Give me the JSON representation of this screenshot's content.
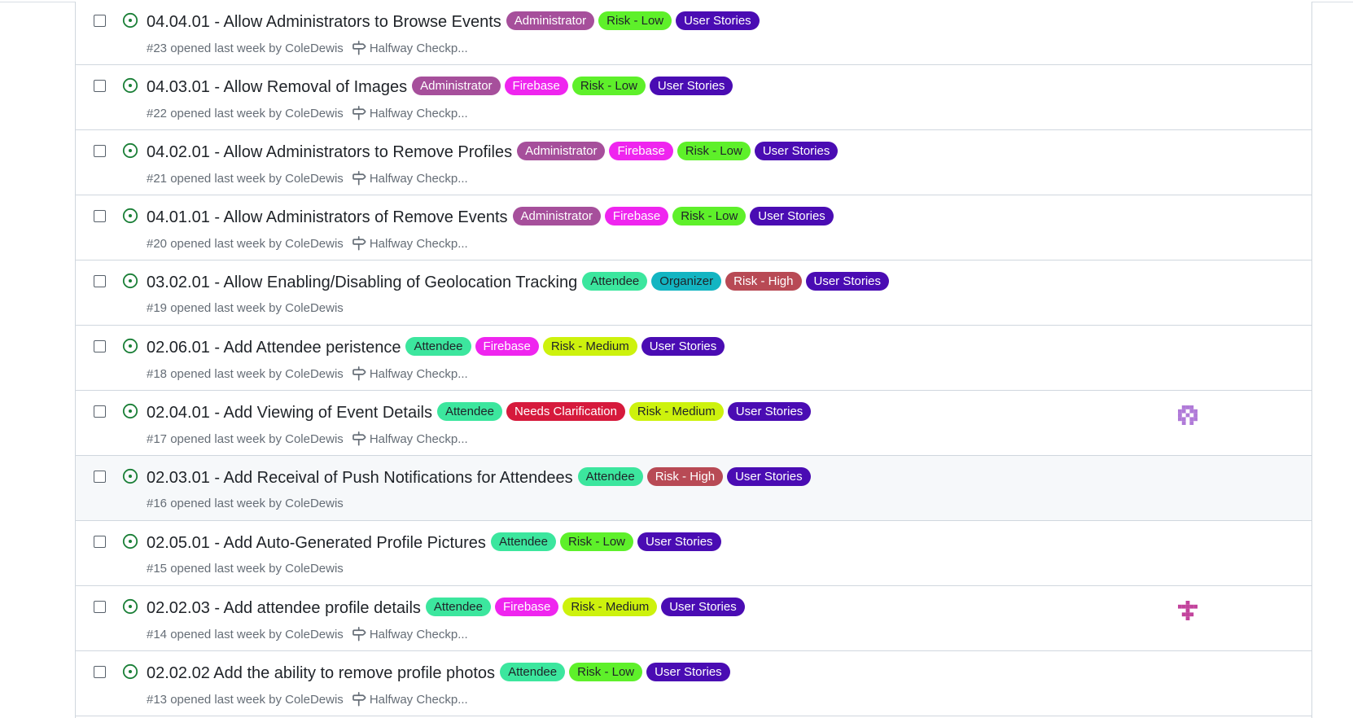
{
  "colors": {
    "Administrator": {
      "bg": "#a64f9b",
      "fg": "#ffffff"
    },
    "Firebase": {
      "bg": "#ef25ef",
      "fg": "#ffffff"
    },
    "Risk - Low": {
      "bg": "#5ef02a",
      "fg": "#1f2328"
    },
    "Risk - Medium": {
      "bg": "#cdf20d",
      "fg": "#1f2328"
    },
    "Risk - High": {
      "bg": "#b84a55",
      "fg": "#ffffff"
    },
    "User Stories": {
      "bg": "#4a0cb3",
      "fg": "#ffffff"
    },
    "Attendee": {
      "bg": "#3ce69e",
      "fg": "#1f2328"
    },
    "Organizer": {
      "bg": "#13b5c2",
      "fg": "#1f2328"
    },
    "Needs Clarification": {
      "bg": "#d61a3c",
      "fg": "#ffffff"
    },
    "open_state": "#1a7f37"
  },
  "issues": [
    {
      "title": "04.04.01 - Allow Administrators to Browse Events",
      "labels": [
        "Administrator",
        "Risk - Low",
        "User Stories"
      ],
      "meta": "#23 opened last week by ColeDewis",
      "milestone": "Halfway Checkp...",
      "avatar": null,
      "highlighted": false
    },
    {
      "title": "04.03.01 - Allow Removal of Images",
      "labels": [
        "Administrator",
        "Firebase",
        "Risk - Low",
        "User Stories"
      ],
      "meta": "#22 opened last week by ColeDewis",
      "milestone": "Halfway Checkp...",
      "avatar": null,
      "highlighted": false
    },
    {
      "title": "04.02.01 - Allow Administrators to Remove Profiles",
      "labels": [
        "Administrator",
        "Firebase",
        "Risk - Low",
        "User Stories"
      ],
      "meta": "#21 opened last week by ColeDewis",
      "milestone": "Halfway Checkp...",
      "avatar": null,
      "highlighted": false
    },
    {
      "title": "04.01.01 - Allow Administrators of Remove Events",
      "labels": [
        "Administrator",
        "Firebase",
        "Risk - Low",
        "User Stories"
      ],
      "meta": "#20 opened last week by ColeDewis",
      "milestone": "Halfway Checkp...",
      "avatar": null,
      "highlighted": false
    },
    {
      "title": "03.02.01 - Allow Enabling/Disabling of Geolocation Tracking",
      "labels": [
        "Attendee",
        "Organizer",
        "Risk - High",
        "User Stories"
      ],
      "meta": "#19 opened last week by ColeDewis",
      "milestone": null,
      "avatar": null,
      "highlighted": false
    },
    {
      "title": "02.06.01 - Add Attendee peristence",
      "labels": [
        "Attendee",
        "Firebase",
        "Risk - Medium",
        "User Stories"
      ],
      "meta": "#18 opened last week by ColeDewis",
      "milestone": "Halfway Checkp...",
      "avatar": null,
      "highlighted": false
    },
    {
      "title": "02.04.01 - Add Viewing of Event Details",
      "labels": [
        "Attendee",
        "Needs Clarification",
        "Risk - Medium",
        "User Stories"
      ],
      "meta": "#17 opened last week by ColeDewis",
      "milestone": "Halfway Checkp...",
      "avatar": "identicon-a",
      "highlighted": false
    },
    {
      "title": "02.03.01 - Add Receival of Push Notifications for Attendees",
      "labels": [
        "Attendee",
        "Risk - High",
        "User Stories"
      ],
      "meta": "#16 opened last week by ColeDewis",
      "milestone": null,
      "avatar": null,
      "highlighted": true
    },
    {
      "title": "02.05.01 - Add Auto-Generated Profile Pictures",
      "labels": [
        "Attendee",
        "Risk - Low",
        "User Stories"
      ],
      "meta": "#15 opened last week by ColeDewis",
      "milestone": null,
      "avatar": null,
      "highlighted": false
    },
    {
      "title": "02.02.03 - Add attendee profile details",
      "labels": [
        "Attendee",
        "Firebase",
        "Risk - Medium",
        "User Stories"
      ],
      "meta": "#14 opened last week by ColeDewis",
      "milestone": "Halfway Checkp...",
      "avatar": "identicon-b",
      "highlighted": false
    },
    {
      "title": "02.02.02 Add the ability to remove profile photos",
      "labels": [
        "Attendee",
        "Risk - Low",
        "User Stories"
      ],
      "meta": "#13 opened last week by ColeDewis",
      "milestone": "Halfway Checkp...",
      "avatar": null,
      "highlighted": false
    }
  ]
}
